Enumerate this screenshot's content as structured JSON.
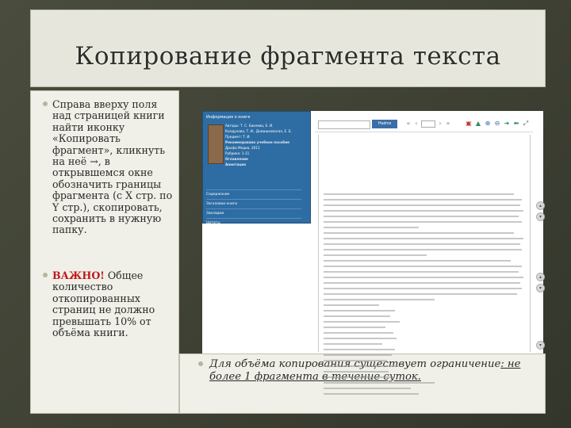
{
  "slide": {
    "title": "Копирование фрагмента текста",
    "bullets": {
      "first_text": "Справа вверху поля над страницей книги найти иконку «Копировать фрагмент», кликнуть на неё →, в открывшемся окне обозначить границы фрагмента (с X стр. по Y стр.), скопировать, сохранить в нужную папку.",
      "second_prefix": "ВАЖНО!",
      "second_rest": " Общее количество откопированных страниц не должно превышать 10% от объёма книги."
    },
    "note": {
      "italic_lead": "Для объёма копирования существует ограничение",
      "underlined_rest": ": не более 1 фрагмента в течение суток."
    }
  },
  "screenshot": {
    "pane_header": "Информация о книге",
    "pane_lines": [
      "Авторы: Т. С. Бакеева, Е. И.",
      "Колдунова, Т. И., Домашковская, Е. Б.",
      "Предмет: Т. И.",
      "Рекомендовано учебное пособие",
      "Дрофа Медиа, 2011",
      "Рубрика: 1-11",
      "Оглавление",
      "Аннотация"
    ],
    "pane_menu": [
      "Содержание",
      "Заголовки книги",
      "Закладки",
      "Цитаты"
    ],
    "find_button": "Найти",
    "toolbar_icons": [
      "first-page-icon",
      "prev-page-icon",
      "page-field-icon",
      "next-page-icon",
      "last-page-icon",
      "copy-fragment-icon",
      "bookmark-icon",
      "zoom-in-icon",
      "zoom-out-icon",
      "arrow-right-icon",
      "arrow-left-icon",
      "fullscreen-icon"
    ]
  }
}
